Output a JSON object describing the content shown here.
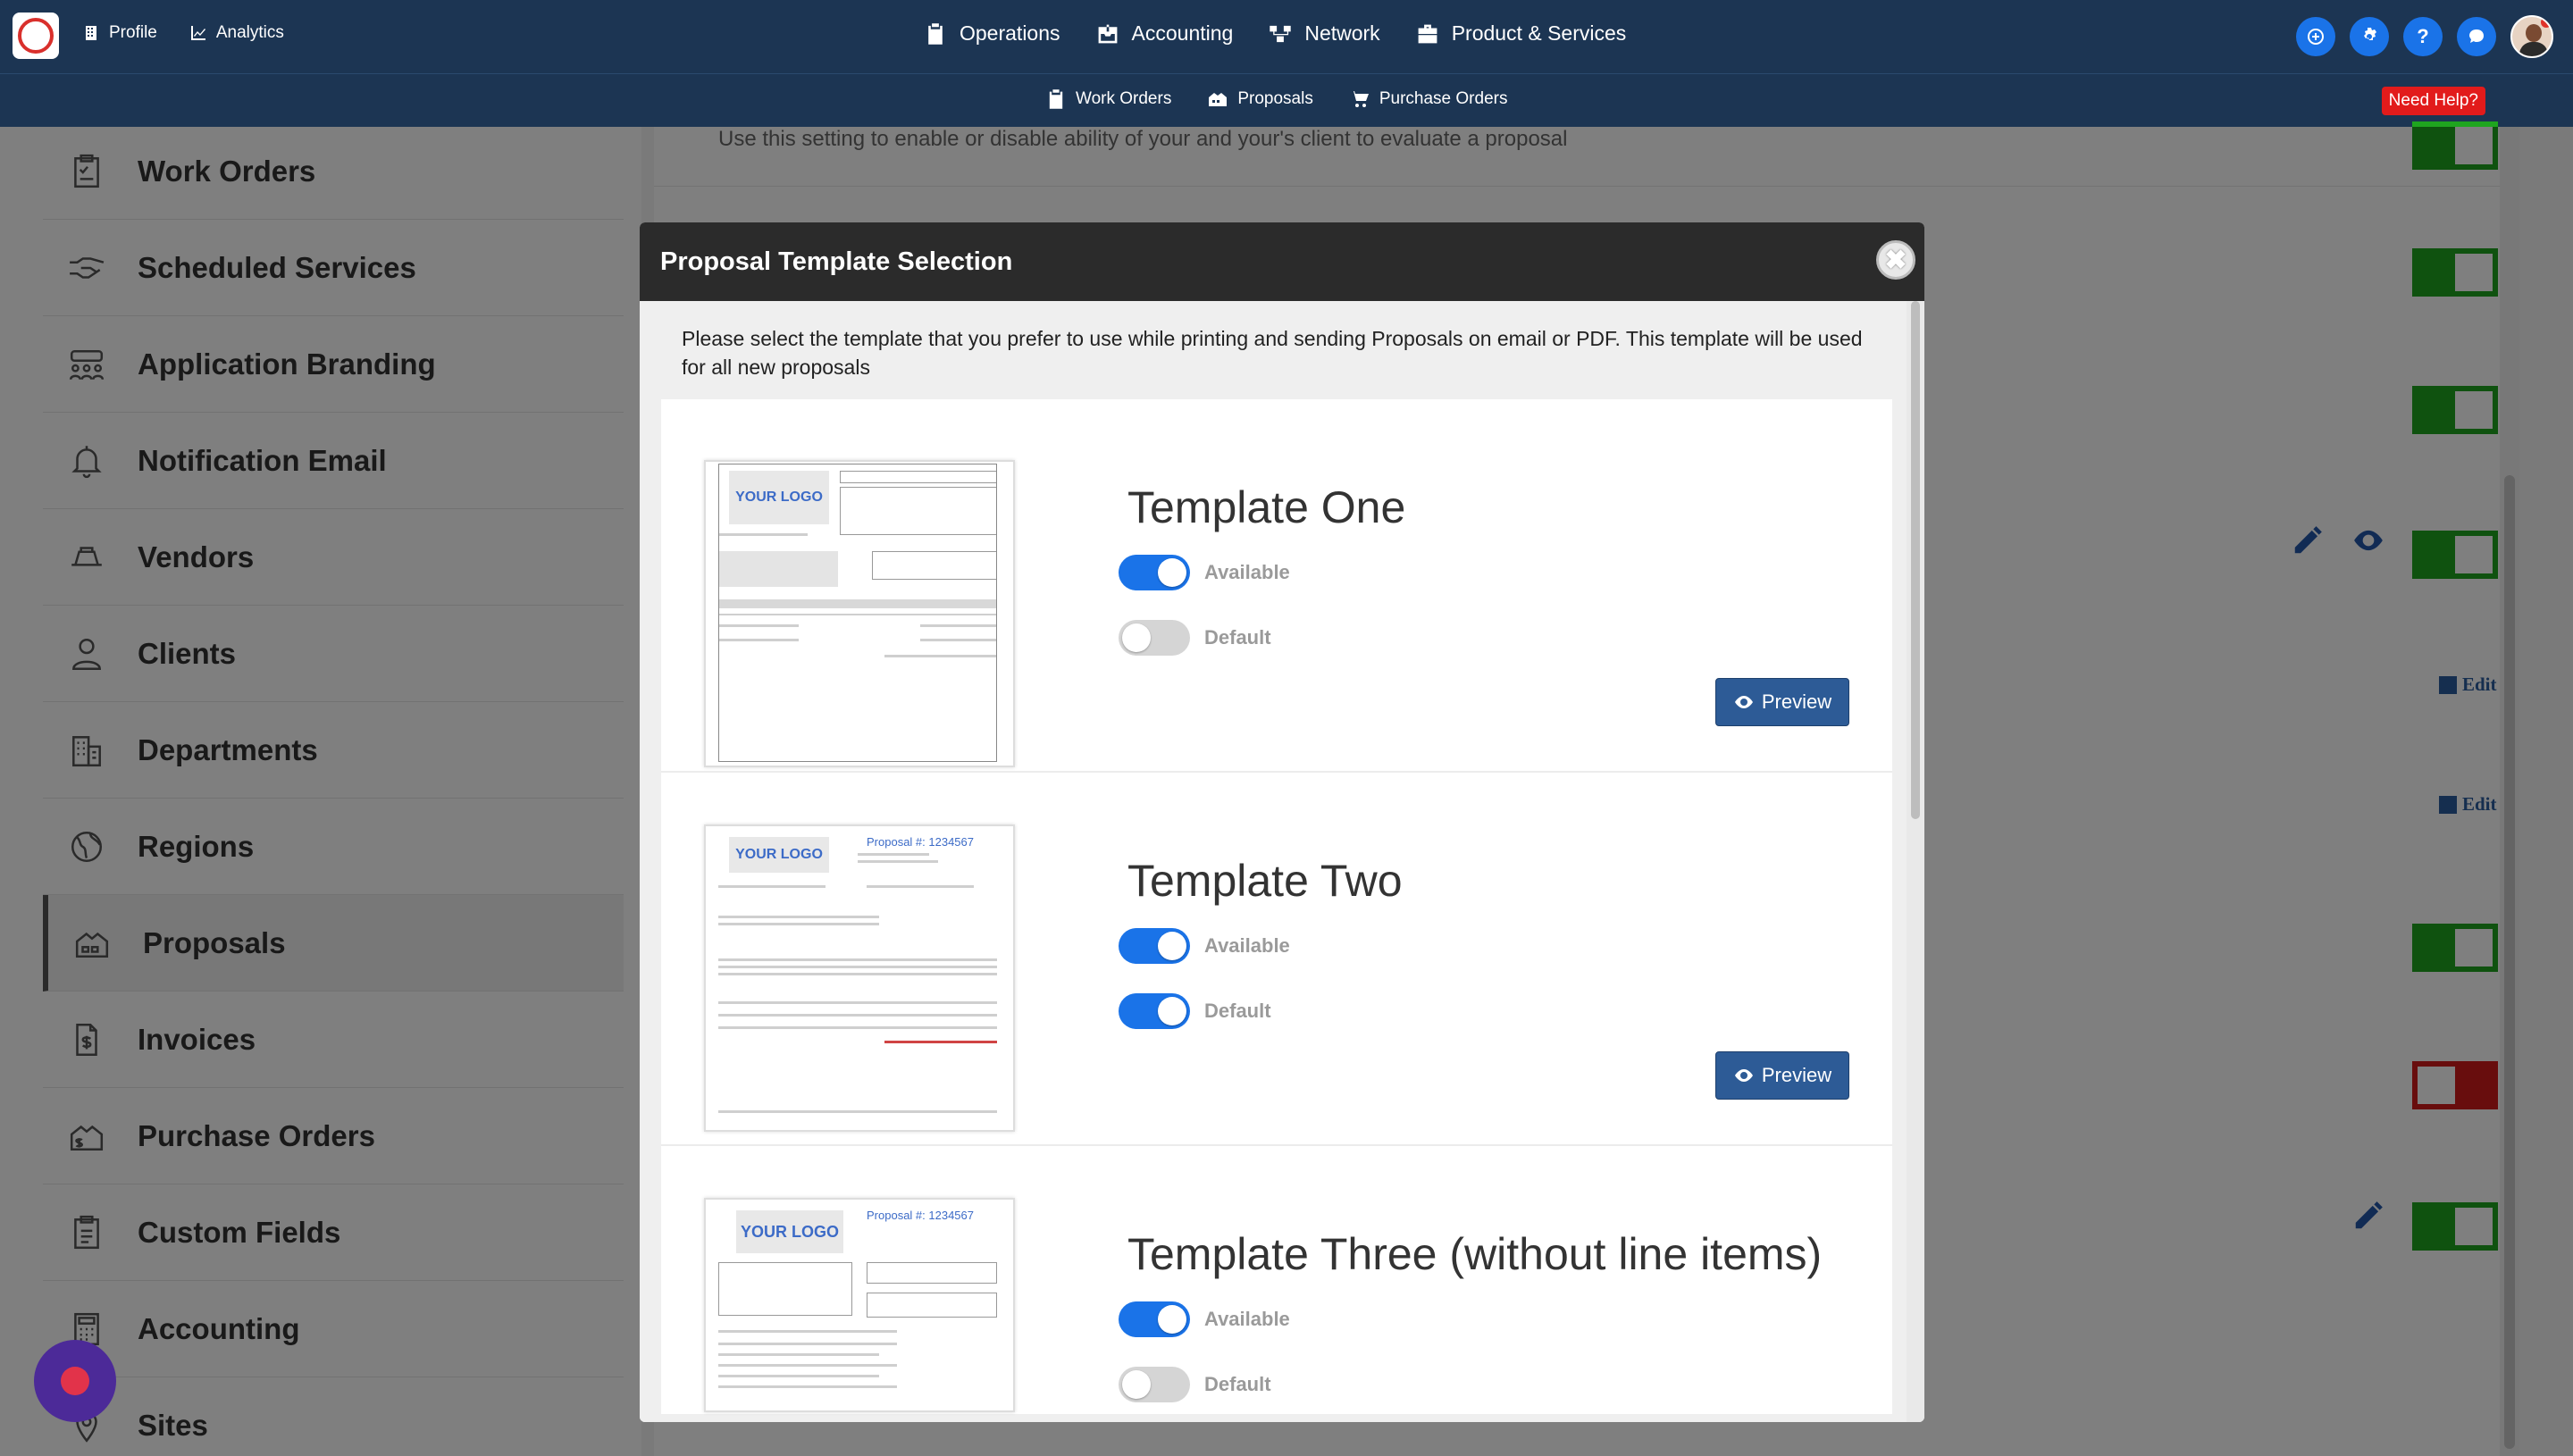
{
  "topnav": {
    "left_items": [
      {
        "label": "Profile",
        "icon": "building-icon"
      },
      {
        "label": "Analytics",
        "icon": "chart-icon"
      }
    ],
    "center_items": [
      {
        "label": "Operations",
        "icon": "clipboard-icon"
      },
      {
        "label": "Accounting",
        "icon": "inbox-dollar-icon"
      },
      {
        "label": "Network",
        "icon": "network-icon"
      },
      {
        "label": "Product & Services",
        "icon": "briefcase-icon"
      }
    ],
    "right_buttons": [
      "plus-circle-icon",
      "gear-icon",
      "help-icon",
      "chat-icon"
    ],
    "help_glyph": "?"
  },
  "subnav": {
    "items": [
      {
        "label": "Work Orders",
        "icon": "clipboard-icon"
      },
      {
        "label": "Proposals",
        "icon": "proposal-icon"
      },
      {
        "label": "Purchase Orders",
        "icon": "cart-icon"
      }
    ],
    "need_help": "Need Help?"
  },
  "sidebar": {
    "items": [
      {
        "label": "Work Orders",
        "icon": "clipboard-check-icon"
      },
      {
        "label": "Scheduled Services",
        "icon": "handshake-icon"
      },
      {
        "label": "Application Branding",
        "icon": "users-group-icon"
      },
      {
        "label": "Notification Email",
        "icon": "bell-icon"
      },
      {
        "label": "Vendors",
        "icon": "truck-icon"
      },
      {
        "label": "Clients",
        "icon": "user-icon"
      },
      {
        "label": "Departments",
        "icon": "building-icon"
      },
      {
        "label": "Regions",
        "icon": "globe-icon"
      },
      {
        "label": "Proposals",
        "icon": "proposal-icon",
        "active": true
      },
      {
        "label": "Invoices",
        "icon": "invoice-icon"
      },
      {
        "label": "Purchase Orders",
        "icon": "purchase-order-icon"
      },
      {
        "label": "Custom Fields",
        "icon": "clipboard-icon"
      },
      {
        "label": "Accounting",
        "icon": "calculator-icon"
      },
      {
        "label": "Sites",
        "icon": "map-pin-icon"
      }
    ]
  },
  "main": {
    "setting_text": "Use this setting to enable or disable ability of your and your's client to evaluate a proposal",
    "edit_label": "Edit"
  },
  "modal": {
    "title": "Proposal Template Selection",
    "close_glyph": "✖",
    "description": "Please select the template that you prefer to use while printing and sending Proposals on email or PDF. This template will be used for all new proposals",
    "available_label": "Available",
    "default_label": "Default",
    "preview_label": "Preview",
    "thumbnail_logo": "YOUR LOGO",
    "thumbnail_proposal_no": "Proposal #: 1234567",
    "templates": [
      {
        "name": "Template One",
        "available": true,
        "default": false
      },
      {
        "name": "Template Two",
        "available": true,
        "default": true
      },
      {
        "name": "Template Three (without line items)",
        "available": true,
        "default": false
      }
    ]
  },
  "colors": {
    "nav_bg": "#1c3553",
    "accent_blue": "#1a73e8",
    "toggle_green": "#1fa51f",
    "toggle_red": "#d11b1b",
    "need_help_red": "#e21b1b",
    "preview_btn": "#2d5b96"
  }
}
